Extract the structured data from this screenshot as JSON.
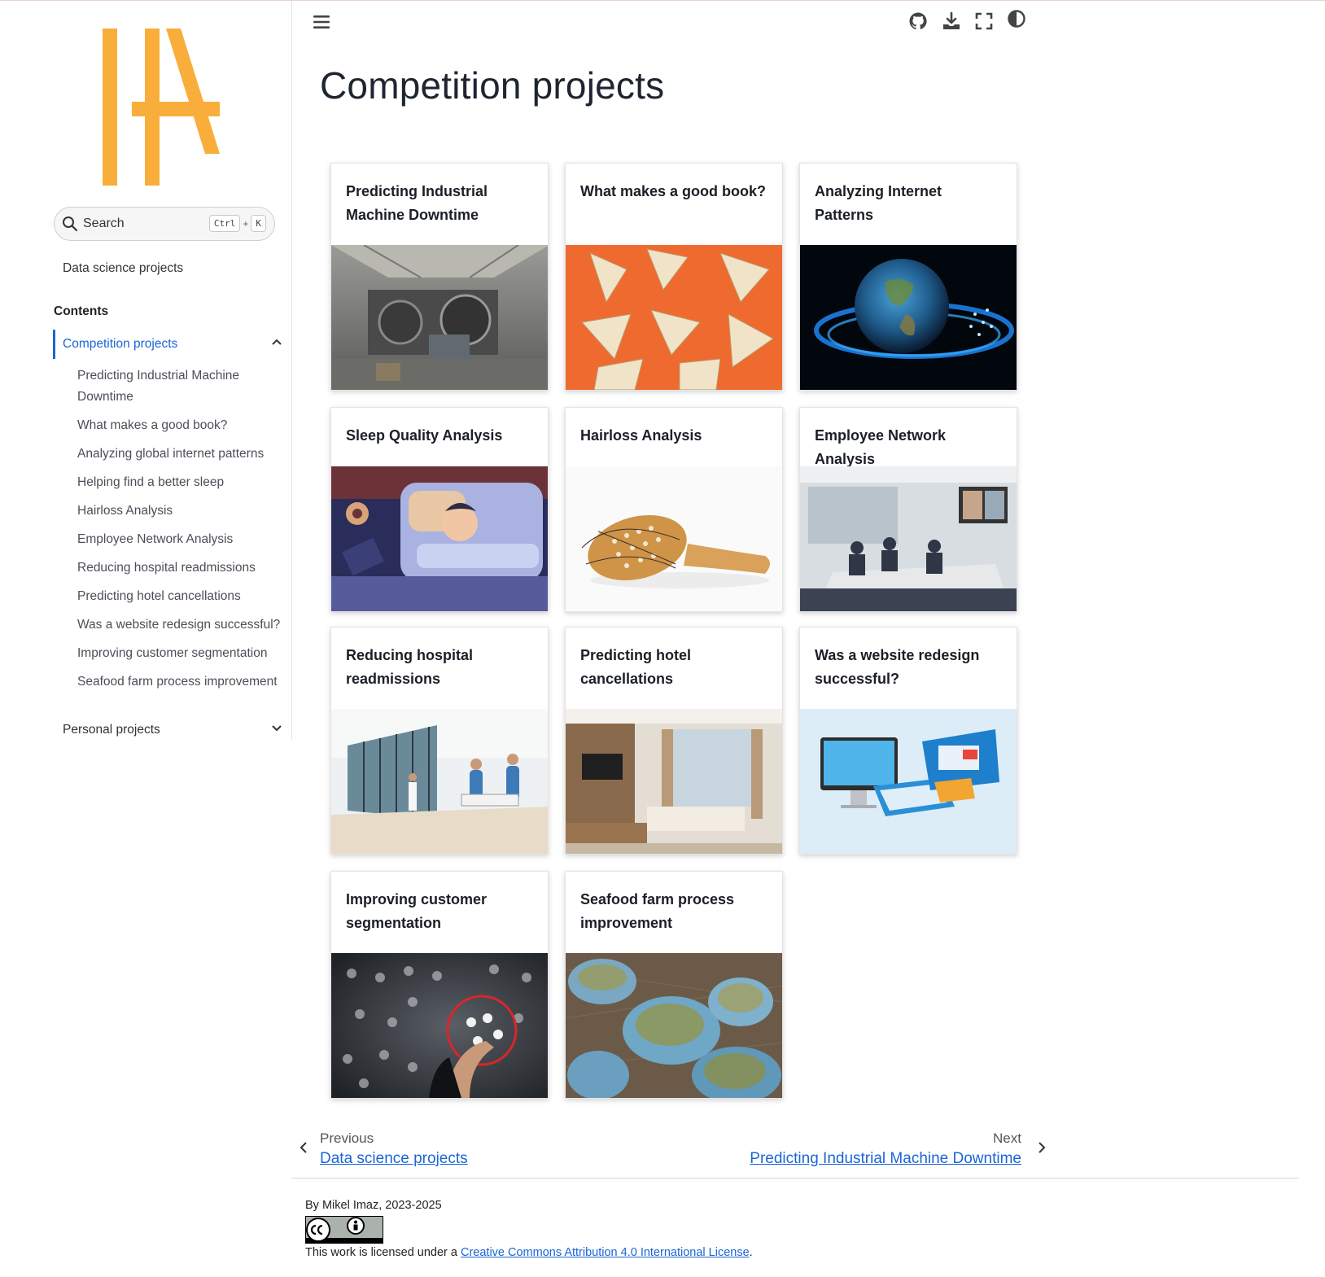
{
  "header": {
    "menu_icon": "hamburger-menu-icon",
    "icons": [
      "github-icon",
      "download-icon",
      "fullscreen-icon",
      "theme-toggle-icon"
    ]
  },
  "sidebar": {
    "logo": "IA-monogram-logo",
    "search": {
      "placeholder": "Search",
      "shortcut_key1": "Ctrl",
      "shortcut_plus": "+",
      "shortcut_key2": "K"
    },
    "top_link": "Data science projects",
    "contents_heading": "Contents",
    "active_section": "Competition projects",
    "sub_items": [
      "Predicting Industrial Machine Downtime",
      "What makes a good book?",
      "Analyzing global internet patterns",
      "Helping find a better sleep",
      "Hairloss Analysis",
      "Employee Network Analysis",
      "Reducing hospital readmissions",
      "Predicting hotel cancellations",
      "Was a website redesign successful?",
      "Improving customer segmentation",
      "Seafood farm process improvement"
    ],
    "collapsed_section": "Personal projects"
  },
  "main": {
    "title": "Competition projects",
    "cards": [
      {
        "title": "Predicting Industrial Machine Downtime"
      },
      {
        "title": "What makes a good book?"
      },
      {
        "title": "Analyzing Internet Patterns"
      },
      {
        "title": "Sleep Quality Analysis"
      },
      {
        "title": "Hairloss Analysis"
      },
      {
        "title": "Employee Network Analysis"
      },
      {
        "title": "Reducing hospital readmissions"
      },
      {
        "title": "Predicting hotel cancellations"
      },
      {
        "title": "Was a website redesign successful?"
      },
      {
        "title": "Improving customer segmentation"
      },
      {
        "title": "Seafood farm process improvement"
      }
    ]
  },
  "pager": {
    "prev_label": "Previous",
    "prev_title": "Data science projects",
    "next_label": "Next",
    "next_title": "Predicting Industrial Machine Downtime"
  },
  "footer": {
    "byline": "By Mikel Imaz, 2023-2025",
    "license_prefix": "This work is licensed under a ",
    "license_link": "Creative Commons Attribution 4.0 International License",
    "license_suffix": ".",
    "badge": "CC BY"
  },
  "colors": {
    "accent": "#1a66d6",
    "logo": "#f9ae3b"
  }
}
